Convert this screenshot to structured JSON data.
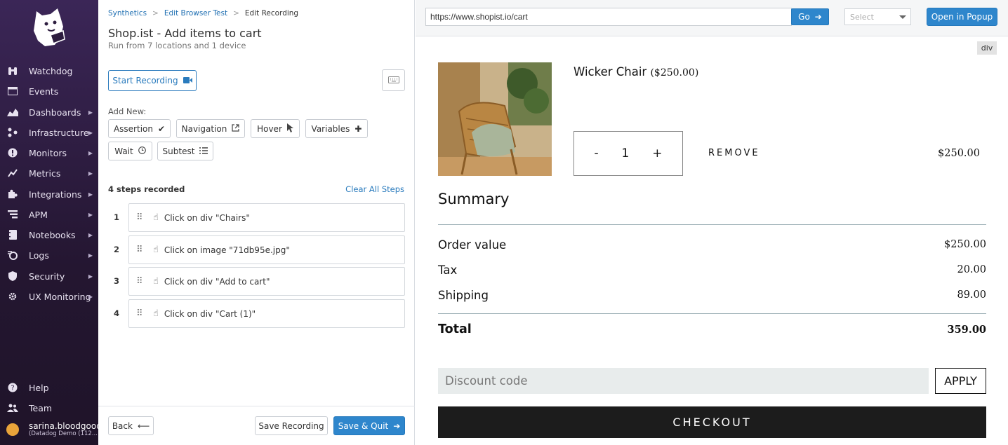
{
  "sidebar": {
    "items": [
      {
        "label": "Watchdog",
        "icon": "binoculars-icon",
        "caret": false
      },
      {
        "label": "Events",
        "icon": "events-icon",
        "caret": false
      },
      {
        "label": "Dashboards",
        "icon": "dashboard-icon",
        "caret": true
      },
      {
        "label": "Infrastructure",
        "icon": "infrastructure-icon",
        "caret": true
      },
      {
        "label": "Monitors",
        "icon": "monitor-alert-icon",
        "caret": true
      },
      {
        "label": "Metrics",
        "icon": "metrics-icon",
        "caret": true
      },
      {
        "label": "Integrations",
        "icon": "puzzle-icon",
        "caret": true
      },
      {
        "label": "APM",
        "icon": "apm-icon",
        "caret": true
      },
      {
        "label": "Notebooks",
        "icon": "notebook-icon",
        "caret": true
      },
      {
        "label": "Logs",
        "icon": "logs-icon",
        "caret": true
      },
      {
        "label": "Security",
        "icon": "shield-icon",
        "caret": true
      },
      {
        "label": "UX Monitoring",
        "icon": "ux-gear-icon",
        "caret": true
      }
    ],
    "bottom": [
      {
        "label": "Help",
        "icon": "help-icon"
      },
      {
        "label": "Team",
        "icon": "team-icon"
      }
    ],
    "user": {
      "name": "sarina.bloodgood",
      "org": "(Datadog Demo (112..."
    }
  },
  "breadcrumb": {
    "items": [
      "Synthetics",
      "Edit Browser Test",
      "Edit Recording"
    ],
    "sep": ">"
  },
  "test": {
    "title": "Shop.ist - Add items to cart",
    "subtitle": "Run from 7 locations and 1 device"
  },
  "recording": {
    "start_label": "Start Recording",
    "add_new_label": "Add New:",
    "add_buttons": {
      "assertion": "Assertion",
      "navigation": "Navigation",
      "hover": "Hover",
      "variables": "Variables",
      "wait": "Wait",
      "subtest": "Subtest"
    },
    "steps_count": "4 steps recorded",
    "clear_all": "Clear All Steps",
    "steps": [
      {
        "num": "1",
        "text": "Click on div \"Chairs\""
      },
      {
        "num": "2",
        "text": "Click on image \"71db95e.jpg\""
      },
      {
        "num": "3",
        "text": "Click on div \"Add to cart\""
      },
      {
        "num": "4",
        "text": "Click on div \"Cart (1)\""
      }
    ]
  },
  "footer": {
    "back": "Back",
    "save_recording": "Save Recording",
    "save_quit": "Save & Quit"
  },
  "browser": {
    "url": "https://www.shopist.io/cart",
    "go": "Go",
    "select_placeholder": "Select",
    "open_popup": "Open in Popup",
    "element_tag": "div"
  },
  "cart": {
    "product_name": "Wicker Chair",
    "product_price": "($250.00)",
    "qty_minus": "-",
    "qty": "1",
    "qty_plus": "+",
    "remove": "REMOVE",
    "line_price": "$250.00",
    "summary_title": "Summary",
    "order_value_label": "Order value",
    "order_value": "$250.00",
    "tax_label": "Tax",
    "tax": "20.00",
    "shipping_label": "Shipping",
    "shipping": "89.00",
    "total_label": "Total",
    "total": "359.00",
    "discount_placeholder": "Discount code",
    "apply": "APPLY",
    "checkout": "CHECKOUT"
  },
  "colors": {
    "sidebar": "#2d1d3f",
    "primary": "#2e86cc",
    "link": "#1f6fb2"
  }
}
